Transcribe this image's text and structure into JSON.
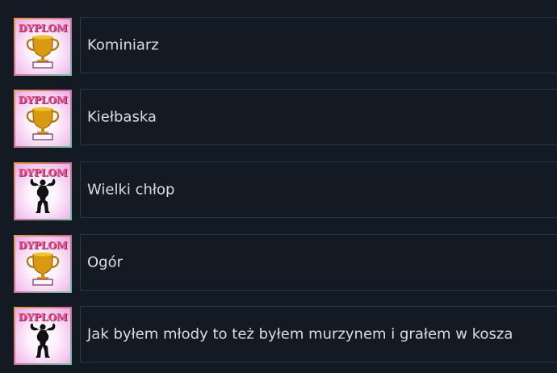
{
  "achievements": [
    {
      "badge_text": "DYPLOM",
      "icon": "trophy-icon",
      "title": "Kominiarz"
    },
    {
      "badge_text": "DYPLOM",
      "icon": "trophy-icon",
      "title": "Kiełbaska"
    },
    {
      "badge_text": "DYPLOM",
      "icon": "bodybuilder-icon",
      "title": "Wielki chłop"
    },
    {
      "badge_text": "DYPLOM",
      "icon": "trophy-icon",
      "title": "Ogór"
    },
    {
      "badge_text": "DYPLOM",
      "icon": "bodybuilder-icon",
      "title": "Jak byłem młody to też byłem murzynem i grałem w kosza"
    }
  ],
  "colors": {
    "background": "#141a23",
    "panel_border": "#25384a",
    "text": "#d9dde3",
    "badge_label": "#e64d86"
  }
}
